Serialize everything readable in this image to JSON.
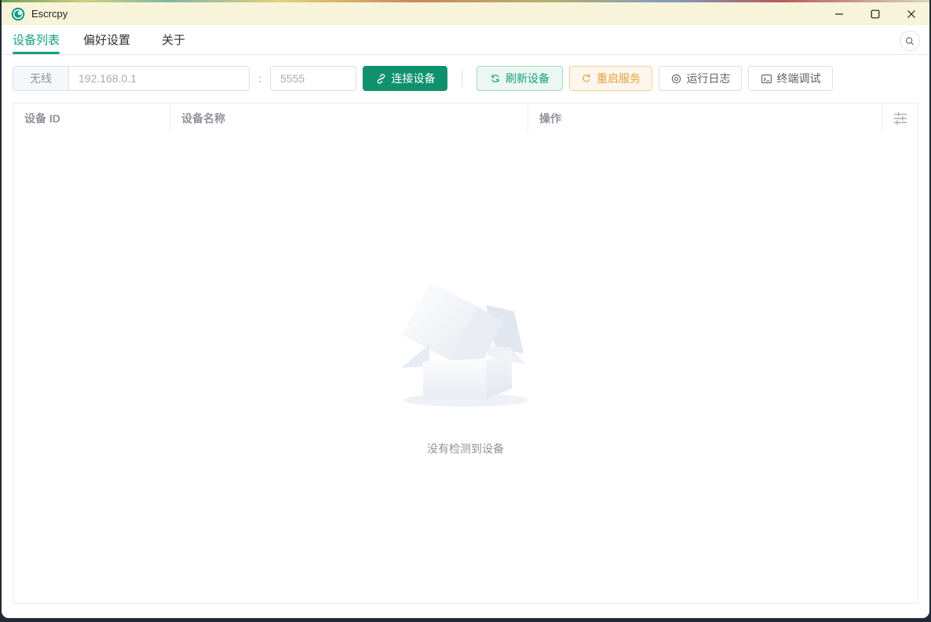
{
  "window": {
    "title": "Escrcpy"
  },
  "tabs": [
    {
      "label": "设备列表",
      "active": true
    },
    {
      "label": "偏好设置",
      "active": false
    },
    {
      "label": "关于",
      "active": false
    }
  ],
  "toolbar": {
    "wireless_label": "无线",
    "ip_placeholder": "192.168.0.1",
    "port_separator": ":",
    "port_placeholder": "5555",
    "connect_label": "连接设备",
    "refresh_label": "刷新设备",
    "restart_label": "重启服务",
    "logs_label": "运行日志",
    "terminal_label": "终端调试"
  },
  "table": {
    "columns": [
      "设备 ID",
      "设备名称",
      "操作"
    ]
  },
  "empty": {
    "text": "没有检测到设备"
  },
  "icons": {
    "titlebar": [
      "app-logo",
      "minimize",
      "maximize",
      "close"
    ],
    "tabbar": [
      "search"
    ],
    "toolbar": [
      "link",
      "refresh",
      "refresh-right",
      "view",
      "terminal"
    ],
    "table": [
      "column-settings-sliders"
    ]
  },
  "colors": {
    "primary": "#14a17e",
    "connect_button": "#10916d",
    "warning": "#e6a23c",
    "titlebar_background": "#f8f4d9",
    "muted_text": "#909399",
    "border": "#dcdfe6",
    "table_border": "#ebeef5"
  }
}
